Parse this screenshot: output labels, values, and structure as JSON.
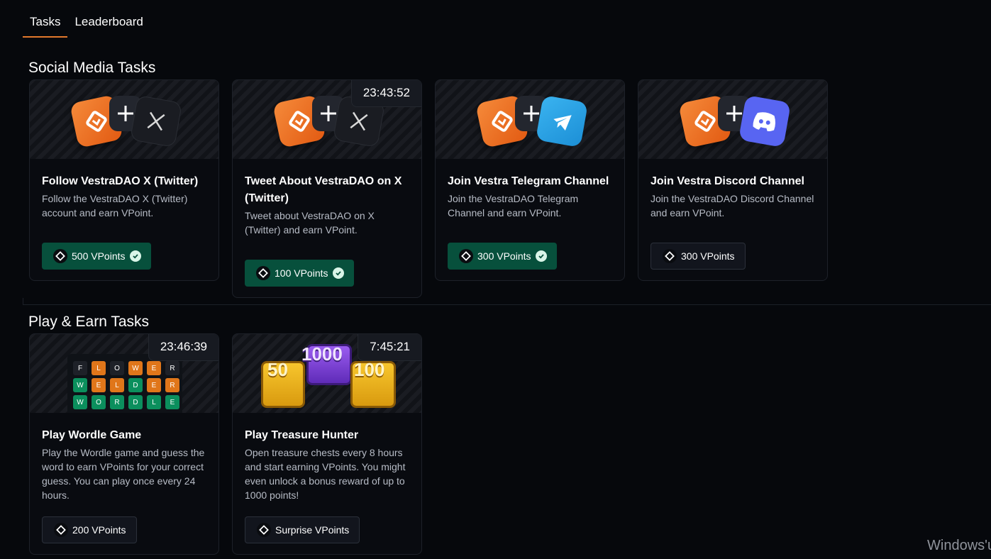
{
  "tabs": [
    {
      "label": "Tasks",
      "active": true
    },
    {
      "label": "Leaderboard",
      "active": false
    }
  ],
  "sections": {
    "social": {
      "title": "Social Media Tasks"
    },
    "play": {
      "title": "Play & Earn Tasks"
    }
  },
  "social_cards": [
    {
      "title": "Follow VestraDAO X (Twitter)",
      "desc": "Follow the VestraDAO X (Twitter) account and earn VPoint.",
      "reward": "500 VPoints",
      "completed": true,
      "icon": "x-logo-icon"
    },
    {
      "title": "Tweet About VestraDAO on X (Twitter)",
      "desc": "Tweet about VestraDAO on X (Twitter) and earn VPoint.",
      "reward": "100 VPoints",
      "completed": true,
      "timer": "23:43:52",
      "icon": "x-logo-icon"
    },
    {
      "title": "Join Vestra Telegram Channel",
      "desc": "Join the VestraDAO Telegram Channel and earn VPoint.",
      "reward": "300 VPoints",
      "completed": true,
      "icon": "telegram-icon"
    },
    {
      "title": "Join Vestra Discord Channel",
      "desc": "Join the VestraDAO Discord Channel and earn VPoint.",
      "reward": "300 VPoints",
      "completed": false,
      "icon": "discord-icon"
    }
  ],
  "play_cards": [
    {
      "title": "Play Wordle Game",
      "desc": "Play the Wordle game and guess the word to earn VPoints for your correct guess. You can play once every 24 hours.",
      "reward": "200 VPoints",
      "completed": false,
      "timer": "23:46:39"
    },
    {
      "title": "Play Treasure Hunter",
      "desc": "Open treasure chests every 8 hours and start earning VPoints. You might even unlock a bonus reward of up to 1000 points!",
      "reward": "Surprise VPoints",
      "completed": false,
      "timer": "7:45:21"
    }
  ],
  "wordle_rows": [
    [
      "F",
      "L",
      "O",
      "W",
      "E",
      "R"
    ],
    [
      "W",
      "E",
      "L",
      "D",
      "E",
      "R"
    ],
    [
      "W",
      "O",
      "R",
      "D",
      "L",
      "E"
    ]
  ],
  "treasure_labels": [
    "50",
    "1000",
    "100"
  ],
  "watermark": "Windows'u",
  "colors": {
    "accent": "#e2782c",
    "done_green": "#07503c",
    "background": "#06080c"
  }
}
